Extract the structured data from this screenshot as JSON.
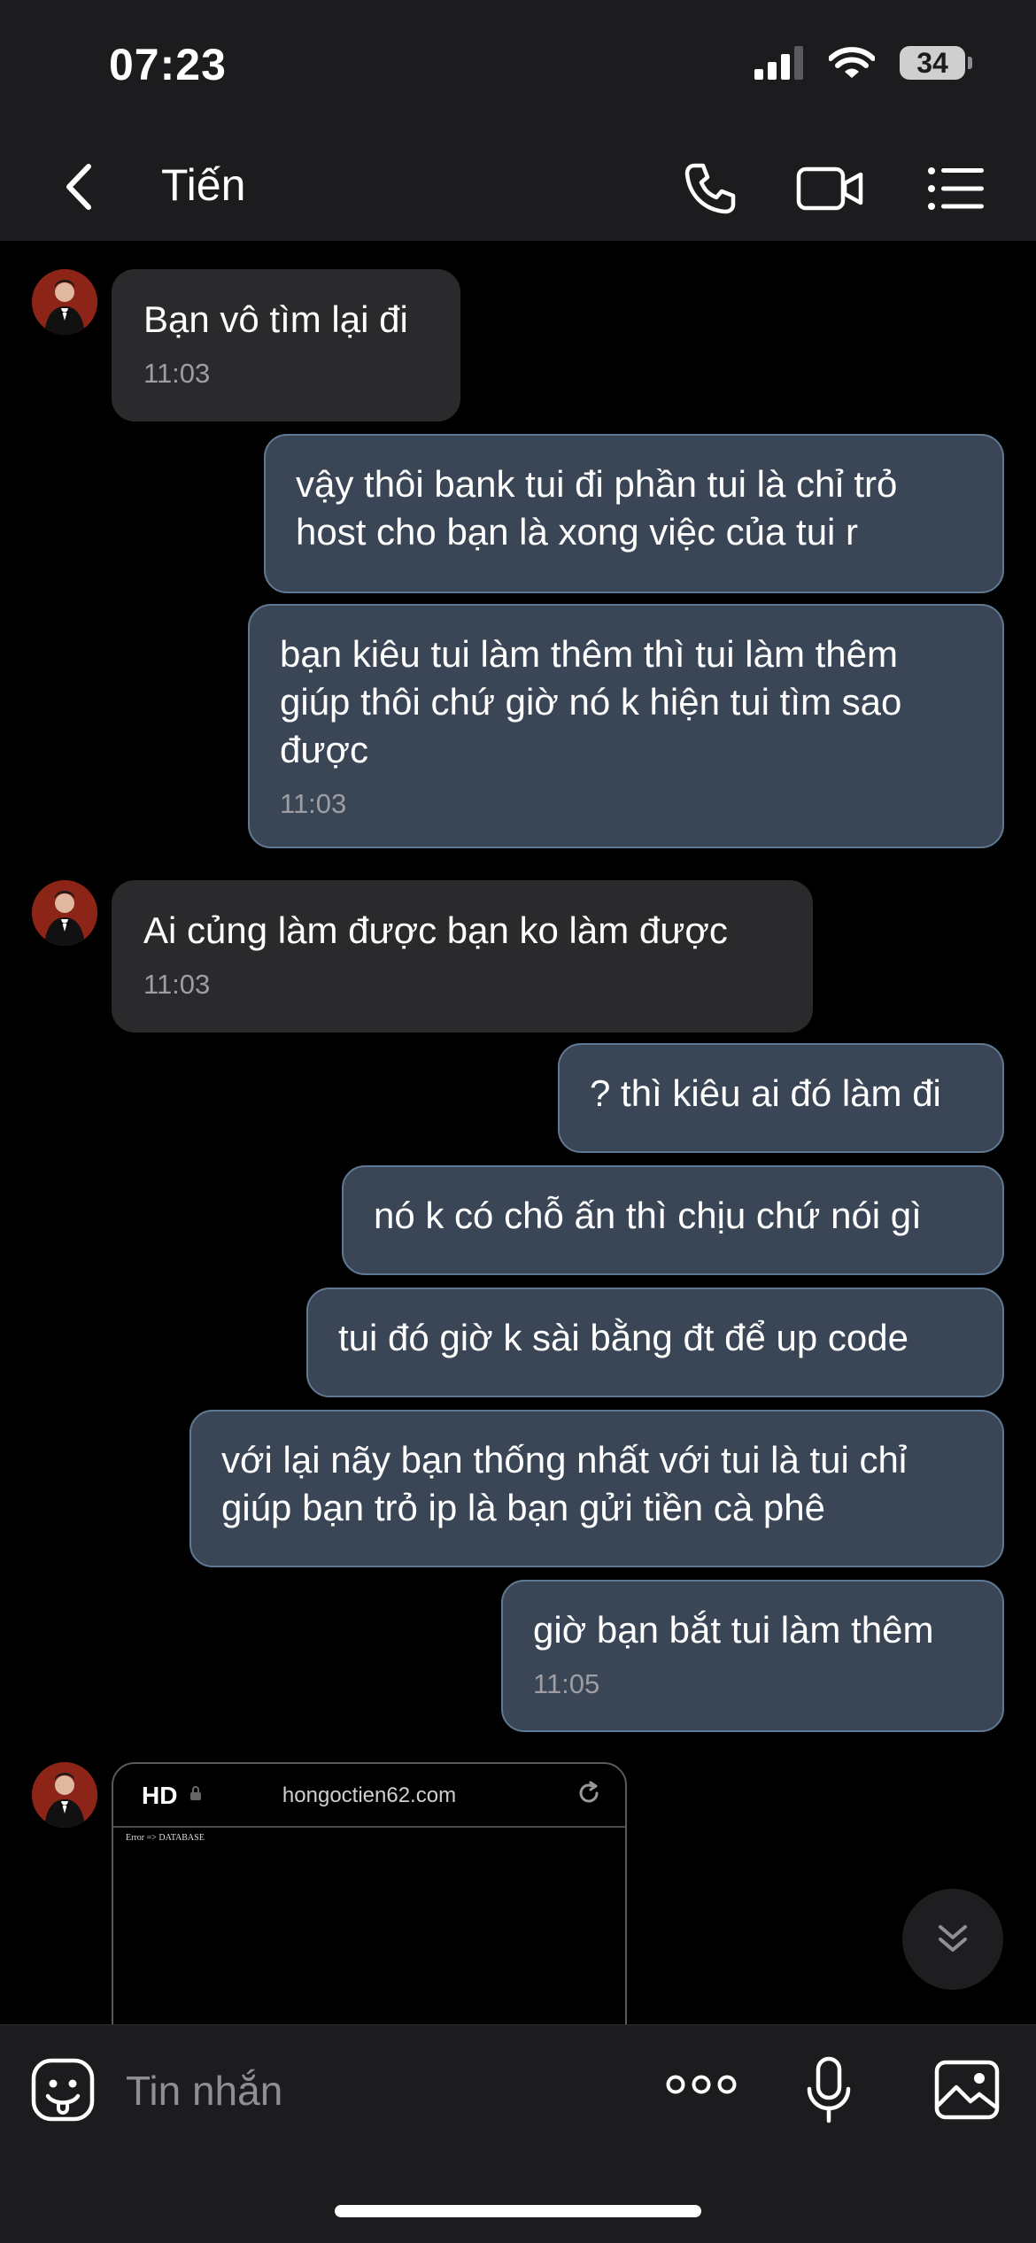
{
  "status_bar": {
    "time": "07:23",
    "battery": "34"
  },
  "header": {
    "contact_name": "Tiến"
  },
  "messages": [
    {
      "dir": "in",
      "text": "Bạn vô tìm lại đi",
      "time": "11:03"
    },
    {
      "dir": "out",
      "text": "vậy thôi bank tui đi phần tui là chỉ trỏ host cho bạn là xong việc của tui r"
    },
    {
      "dir": "out",
      "text": "bạn kiêu tui làm thêm thì tui làm thêm giúp thôi chứ giờ nó k hiện tui tìm sao được",
      "time": "11:03"
    },
    {
      "dir": "in",
      "text": "Ai củng làm được bạn ko làm được",
      "time": "11:03"
    },
    {
      "dir": "out",
      "text": "? thì kiêu ai đó làm đi"
    },
    {
      "dir": "out",
      "text": "nó k có chỗ ấn thì chịu chứ nói gì"
    },
    {
      "dir": "out",
      "text": "tui đó giờ k sài bằng đt để up code"
    },
    {
      "dir": "out",
      "text": "với lại nãy bạn thống nhất với tui là tui chỉ giúp bạn trỏ ip là bạn gửi tiền cà phê"
    },
    {
      "dir": "out",
      "text": "giờ bạn bắt tui làm thêm",
      "time": "11:05"
    }
  ],
  "preview": {
    "badge": "HD",
    "url": "hongoctien62.com",
    "body_text": "Error => DATABASE"
  },
  "input": {
    "placeholder": "Tin nhắn"
  },
  "icons": {
    "back": "chevron-left-icon",
    "call": "phone-icon",
    "video": "video-camera-icon",
    "menu": "list-menu-icon",
    "sticker": "sticker-smiley-icon",
    "more": "more-dots-icon",
    "mic": "microphone-icon",
    "image": "image-gallery-icon",
    "scroll": "double-chevron-down-icon"
  },
  "colors": {
    "incoming_bubble": "#2a2a2c",
    "outgoing_bubble": "#3a4656",
    "outgoing_border": "#5f7893",
    "bar_bg": "#1c1c1e"
  }
}
